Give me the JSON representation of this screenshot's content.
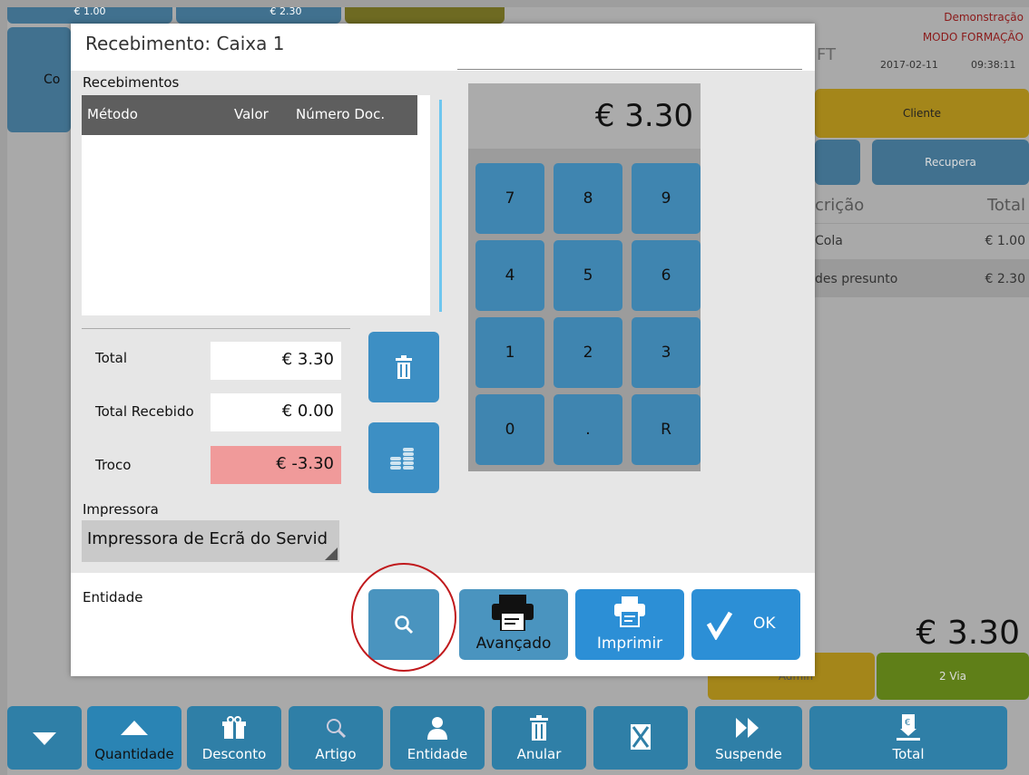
{
  "background": {
    "top_prices": [
      "€ 1.00",
      "€ 2.30"
    ],
    "demo_label": "Demonstração",
    "training_label": "MODO FORMAÇÃO",
    "app_fragment": "FT",
    "date": "2017-02-11",
    "time": "09:38:11",
    "left_fragment": "Co",
    "cliente_label": "Cliente",
    "recupera_label": "Recupera",
    "col_desc_fragment": "crição",
    "col_total": "Total",
    "rows": [
      {
        "desc": "Cola",
        "price": "€ 1.00"
      },
      {
        "desc": "des presunto",
        "price": "€ 2.30"
      }
    ],
    "big_total": "€ 3.30",
    "admin_fragment": "Admin",
    "second_via": "2 Via"
  },
  "toolbar": {
    "quantidade": "Quantidade",
    "desconto": "Desconto",
    "artigo": "Artigo",
    "entidade": "Entidade",
    "anular": "Anular",
    "suspende": "Suspende",
    "total": "Total"
  },
  "dialog": {
    "title": "Recebimento: Caixa 1",
    "receipts_label": "Recebimentos",
    "table_headers": {
      "method": "Método",
      "value": "Valor",
      "doc": "Número Doc."
    },
    "amount_display": "€ 3.30",
    "keypad": [
      "7",
      "8",
      "9",
      "4",
      "5",
      "6",
      "1",
      "2",
      "3",
      "0",
      ".",
      "R"
    ],
    "total_label": "Total",
    "total_value": "€ 3.30",
    "received_label": "Total Recebido",
    "received_value": "€ 0.00",
    "change_label": "Troco",
    "change_value": "€ -3.30",
    "printer_label": "Impressora",
    "printer_value": "Impressora de Ecrã do Servid",
    "entity_label": "Entidade",
    "advanced_label": "Avançado",
    "print_label": "Imprimir",
    "ok_label": "OK"
  },
  "colors": {
    "keypad_blue": "#3f85b0",
    "action_blue": "#2c8fd6",
    "change_red": "#f09a9a",
    "highlight_circle": "#c0191c"
  }
}
